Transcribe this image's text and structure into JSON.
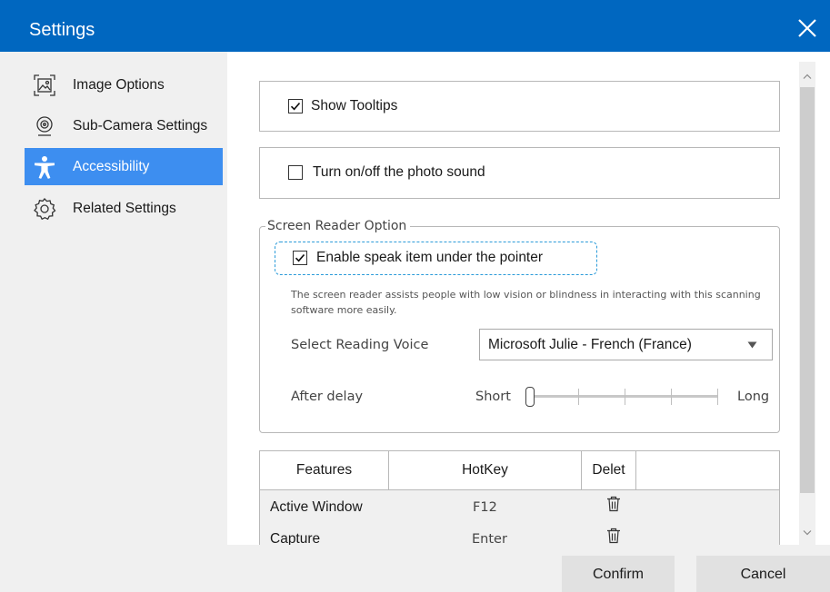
{
  "window": {
    "title": "Settings"
  },
  "sidebar": {
    "items": [
      {
        "label": "Image Options",
        "icon": "image-options-icon"
      },
      {
        "label": "Sub-Camera Settings",
        "icon": "webcam-icon"
      },
      {
        "label": "Accessibility",
        "icon": "accessibility-icon",
        "active": true
      },
      {
        "label": "Related Settings",
        "icon": "gear-icon"
      }
    ]
  },
  "options": {
    "show_tooltips": {
      "label": "Show Tooltips",
      "checked": true
    },
    "photo_sound": {
      "label": "Turn on/off the photo sound",
      "checked": false
    }
  },
  "screen_reader": {
    "legend": "Screen Reader Option",
    "enable_speak": {
      "label": "Enable speak item under the pointer",
      "checked": true
    },
    "description": "The screen reader assists people with low vision or blindness in interacting with this scanning software more easily.",
    "voice_label": "Select Reading Voice",
    "voice_value": "Microsoft Julie - French (France)",
    "delay_label": "After delay",
    "delay_short": "Short",
    "delay_long": "Long",
    "delay_level": 0
  },
  "hotkeys": {
    "headers": {
      "features": "Features",
      "hotkey": "HotKey",
      "delete": "Delet"
    },
    "rows": [
      {
        "feature": "Active Window",
        "key": "F12"
      },
      {
        "feature": "Capture",
        "key": "Enter"
      }
    ]
  },
  "footer": {
    "confirm": "Confirm",
    "cancel": "Cancel"
  },
  "colors": {
    "titlebar": "#0067c0",
    "active_item": "#3d8ef0",
    "focus_ring": "#2b9bd9",
    "panel": "#f0f0f0"
  }
}
